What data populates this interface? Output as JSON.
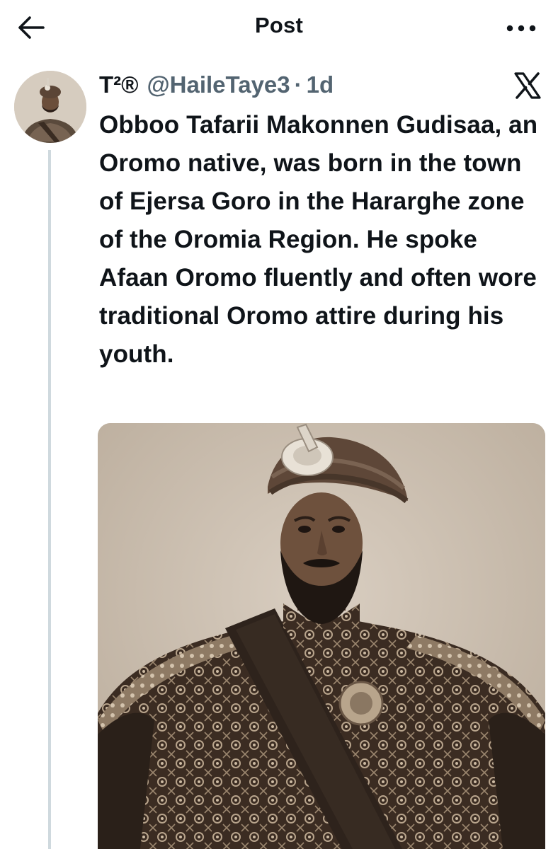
{
  "header": {
    "title": "Post",
    "back_icon": "back-arrow-icon",
    "more_icon": "more-horizontal-icon"
  },
  "post": {
    "display_name": "T²®",
    "handle": "@HaileTaye3",
    "separator": "·",
    "time": "1d",
    "platform_icon": "x-logo-icon",
    "text": "Obboo Tafarii Makonnen Gudisaa, an Oromo native, was born in the town of Ejersa Goro in the Hararghe zone of the Oromia Region. He spoke Afaan Oromo fluently and often wore traditional Oromo attire during his youth."
  },
  "colors": {
    "text_primary": "#0f1419",
    "text_secondary": "#536471",
    "thread_line": "#cfd9de",
    "background": "#ffffff"
  }
}
